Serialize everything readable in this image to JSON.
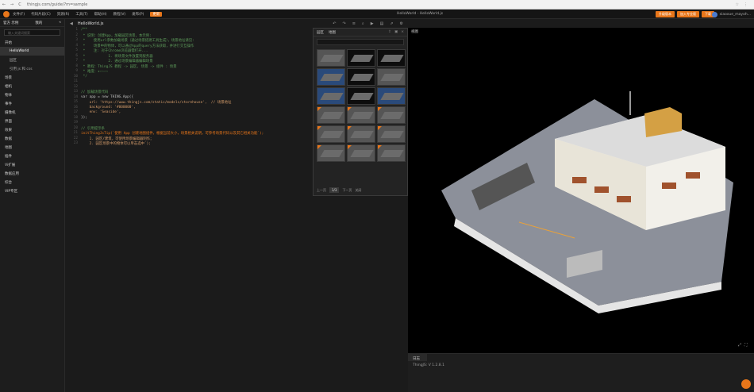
{
  "browser": {
    "url": "thingjs.com/guide/?m=sample",
    "back": "←",
    "forward": "→",
    "reload": "C"
  },
  "app": {
    "menu": [
      "文件(F)",
      "代码片段(C)",
      "资源(R)",
      "工具(T)",
      "帮助(H)",
      "教程(V)",
      "发布(P)",
      "更新"
    ],
    "window_title": "HelloWorld - HelloWorld.js",
    "actions": [
      "升级版本",
      "加入专业版",
      "下载"
    ],
    "user": "xiaoxue_mayoh..."
  },
  "sidebar": {
    "tabs": [
      "官方 示例",
      "我的"
    ],
    "search_placeholder": "输入关键词搜索",
    "items": [
      {
        "label": "开始"
      },
      {
        "label": "HelloWorld",
        "sub": true,
        "active": true
      },
      {
        "label": "园区",
        "sub": true
      },
      {
        "label": "引用 js 和 css",
        "sub": true
      },
      {
        "label": "场景"
      },
      {
        "label": "相机"
      },
      {
        "label": "物体"
      },
      {
        "label": "事件"
      },
      {
        "label": "摄像机"
      },
      {
        "label": "界面"
      },
      {
        "label": "效果"
      },
      {
        "label": "数据"
      },
      {
        "label": "地图"
      },
      {
        "label": "插件"
      },
      {
        "label": "Vi扩展"
      },
      {
        "label": "数据应用"
      },
      {
        "label": "综合"
      },
      {
        "label": "VIP专区"
      }
    ]
  },
  "editor": {
    "tab": "HelloWorld.js",
    "lines": [
      [
        "1",
        "/**",
        "cl"
      ],
      [
        "2",
        " * 说明：创建App，加载园区场景，本示例:",
        "cl"
      ],
      [
        "3",
        " *    使用url参数加载场景（通过场景搭建工具生成），场景地址请见:",
        "cl"
      ],
      [
        "4",
        " *    场景中的物体，可以通过App的query方法获取，并进行交互操作",
        "cl"
      ],
      [
        "5",
        " *    注: 对于Chrome浏览器需打开...",
        "cl"
      ],
      [
        "6",
        " *           1. 将场景文件放置到服务器",
        "cl"
      ],
      [
        "7",
        " *           2. 通过场景编辑器编辑场景",
        "cl"
      ],
      [
        "8",
        " * 教程：ThingJS 教程 -> 园区, 场景 -> 组件 : 场景",
        "cl"
      ],
      [
        "9",
        " * 难度：★☆☆☆☆",
        "cl"
      ],
      [
        "10",
        " */",
        "cl"
      ],
      [
        "11",
        "",
        ""
      ],
      [
        "12",
        "",
        ""
      ],
      [
        "13",
        "// 加载场景代码",
        "cl"
      ],
      [
        "14",
        "var app = new THING.App({",
        "ck"
      ],
      [
        "15",
        "    url: 'https://www.thingjs.com/static/models/storehouse',  // 场景地址",
        "cs"
      ],
      [
        "16",
        "    background: '#000000',",
        "cs"
      ],
      [
        "17",
        "    env: 'Seaside',",
        "cs"
      ],
      [
        "18",
        "});",
        "ck"
      ],
      [
        "19",
        "",
        ""
      ],
      [
        "20",
        "// 引用提示条",
        "cl"
      ],
      [
        "21",
        "initThingJsTip(`使用 App 创建地图组件，根据当前大小，场景相关说明，可参考场景代码以及其它相关功能`);",
        "co"
      ],
      [
        "22",
        "    1. 园区/建筑，可使用场景编辑器制作；",
        "cs"
      ],
      [
        "23",
        "    2. 园区场景中的物体可以单击选中`);",
        "cs"
      ]
    ]
  },
  "toolbar_icons": [
    "undo-icon",
    "redo-icon",
    "format-icon",
    "search-icon",
    "run-icon",
    "save-icon",
    "share-icon",
    "settings-icon"
  ],
  "resource_panel": {
    "tabs": [
      "园区",
      "地图"
    ],
    "footer": [
      "1/3",
      "上一页",
      "下一页",
      "关闭"
    ],
    "label": "资源"
  },
  "thumbs": [
    "l",
    "k",
    "k",
    "b",
    "k",
    "l",
    "b",
    "k",
    "b",
    "l",
    "l",
    "l",
    "l",
    "l",
    "l",
    "l",
    "l",
    "l"
  ],
  "view": {
    "tab": "视图"
  },
  "console": {
    "tab": "日志",
    "output": "ThingJS: V 1.2.8.1"
  }
}
